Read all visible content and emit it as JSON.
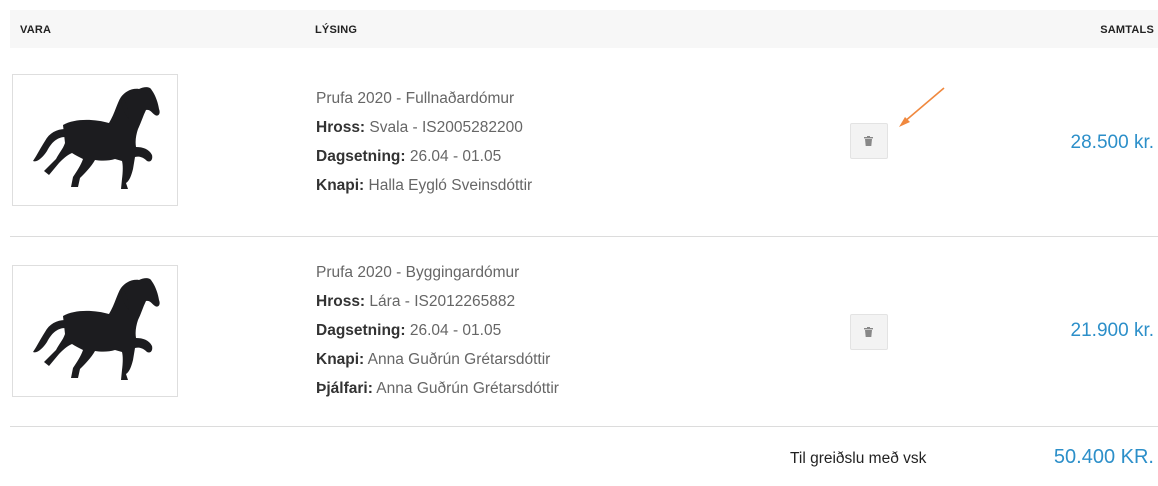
{
  "table": {
    "headers": {
      "item": "VARA",
      "description": "LÝSING",
      "total": "SAMTALS"
    }
  },
  "items": [
    {
      "title": "Prufa 2020 - Fullnaðardómur",
      "lines": [
        {
          "label": "Hross:",
          "value": " Svala - IS2005282200"
        },
        {
          "label": "Dagsetning:",
          "value": " 26.04 - 01.05"
        },
        {
          "label": "Knapi:",
          "value": " Halla Eygló Sveinsdóttir"
        }
      ],
      "price": "28.500 kr.",
      "image_icon": "horse-silhouette-icon"
    },
    {
      "title": "Prufa 2020 - Byggingardómur",
      "lines": [
        {
          "label": "Hross:",
          "value": " Lára - IS2012265882"
        },
        {
          "label": "Dagsetning:",
          "value": " 26.04 - 01.05"
        },
        {
          "label": "Knapi:",
          "value": " Anna Guðrún Grétarsdóttir"
        },
        {
          "label": "Þjálfari:",
          "value": " Anna Guðrún Grétarsdóttir"
        }
      ],
      "price": "21.900 kr.",
      "image_icon": "horse-silhouette-icon"
    }
  ],
  "summary": {
    "label": "Til greiðslu með vsk",
    "total": "50.400 KR."
  },
  "colors": {
    "price": "#2c8fc9",
    "arrow": "#f0883e",
    "divider": "#dcdcdc"
  }
}
